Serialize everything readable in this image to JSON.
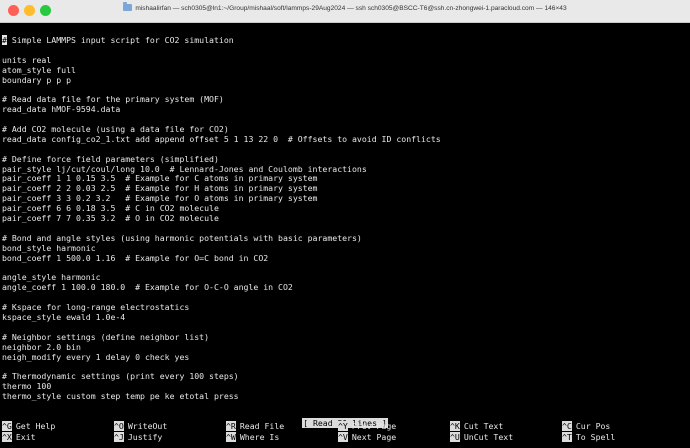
{
  "window": {
    "title": "mishaalirfan — sch0305@ln1:~/Group/mishaal/soft/lammps-29Aug2024 — ssh sch0305@BSCC-T6@ssh.cn-zhongwei-1.paracloud.com — 146×43"
  },
  "editor": {
    "cursor_char": "#",
    "lines": [
      " Simple LAMMPS input script for CO2 simulation",
      "",
      "units real",
      "atom_style full",
      "boundary p p p",
      "",
      "# Read data file for the primary system (MOF)",
      "read_data hMOF-9594.data",
      "",
      "# Add CO2 molecule (using a data file for CO2)",
      "read_data config_co2_1.txt add append offset 5 1 13 22 0  # Offsets to avoid ID conflicts",
      "",
      "# Define force field parameters (simplified)",
      "pair_style lj/cut/coul/long 10.0  # Lennard-Jones and Coulomb interactions",
      "pair_coeff 1 1 0.15 3.5  # Example for C atoms in primary system",
      "pair_coeff 2 2 0.03 2.5  # Example for H atoms in primary system",
      "pair_coeff 3 3 0.2 3.2   # Example for O atoms in primary system",
      "pair_coeff 6 6 0.18 3.5  # C in CO2 molecule",
      "pair_coeff 7 7 0.35 3.2  # O in CO2 molecule",
      "",
      "# Bond and angle styles (using harmonic potentials with basic parameters)",
      "bond_style harmonic",
      "bond_coeff 1 500.0 1.16  # Example for O=C bond in CO2",
      "",
      "angle_style harmonic",
      "angle_coeff 1 100.0 180.0  # Example for O-C-O angle in CO2",
      "",
      "# Kspace for long-range electrostatics",
      "kspace_style ewald 1.0e-4",
      "",
      "# Neighbor settings (define neighbor list)",
      "neighbor 2.0 bin",
      "neigh_modify every 1 delay 0 check yes",
      "",
      "# Thermodynamic settings (print every 100 steps)",
      "thermo 100",
      "thermo_style custom step temp pe ke etotal press"
    ]
  },
  "status_message": "[ Read 51 lines ]",
  "shortcuts": [
    [
      {
        "key": "^G",
        "label": "Get Help"
      },
      {
        "key": "^X",
        "label": "Exit"
      }
    ],
    [
      {
        "key": "^O",
        "label": "WriteOut"
      },
      {
        "key": "^J",
        "label": "Justify"
      }
    ],
    [
      {
        "key": "^R",
        "label": "Read File"
      },
      {
        "key": "^W",
        "label": "Where Is"
      }
    ],
    [
      {
        "key": "^Y",
        "label": "Prev Page"
      },
      {
        "key": "^V",
        "label": "Next Page"
      }
    ],
    [
      {
        "key": "^K",
        "label": "Cut Text"
      },
      {
        "key": "^U",
        "label": "UnCut Text"
      }
    ],
    [
      {
        "key": "^C",
        "label": "Cur Pos"
      },
      {
        "key": "^T",
        "label": "To Spell"
      }
    ]
  ],
  "colors": {
    "background": "#000000",
    "text": "#e8e8e8",
    "inverse_bg": "#dcdcdc",
    "titlebar": "#e9e9e9"
  }
}
